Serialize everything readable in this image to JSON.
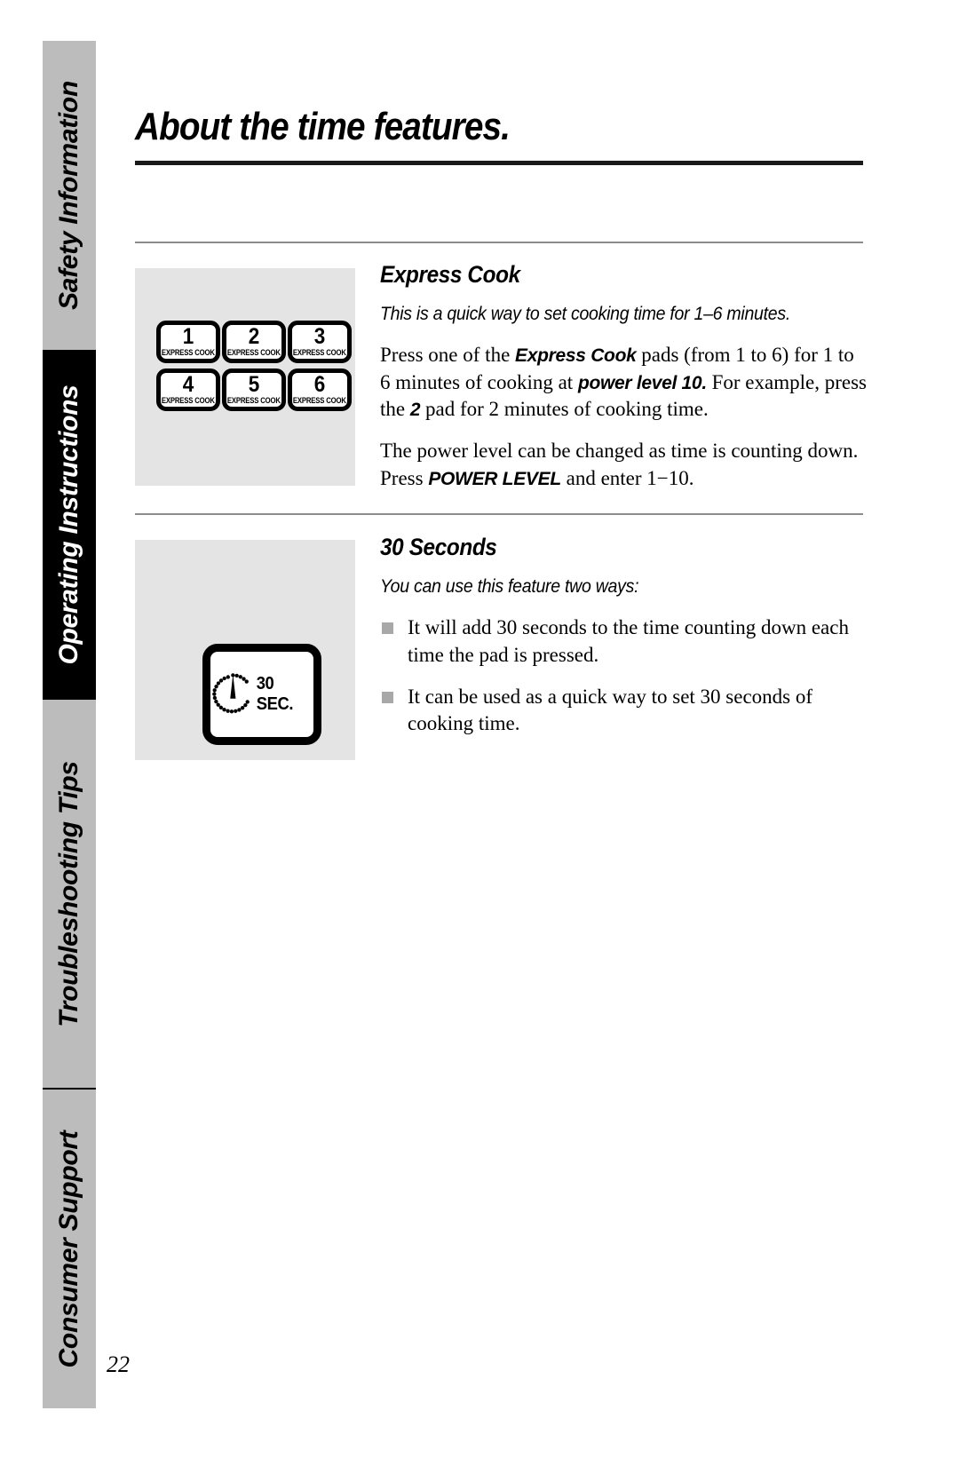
{
  "page": {
    "title": "About the time features.",
    "number": "22"
  },
  "sidebar": {
    "tabs": [
      {
        "label": "Safety Information",
        "active": false
      },
      {
        "label": "Operating Instructions",
        "active": true
      },
      {
        "label": "Troubleshooting Tips",
        "active": false
      },
      {
        "label": "Consumer Support",
        "active": false
      }
    ]
  },
  "sections": {
    "express_cook": {
      "heading": "Express Cook",
      "intro": "This is a quick way to set cooking time for 1–6 minutes.",
      "para1_a": "Press one of the ",
      "para1_emph1": "Express Cook",
      "para1_b": " pads (from 1 to 6) for 1 to 6 minutes of cooking at ",
      "para1_emph2": "power level 10.",
      "para1_c": " For example, press the ",
      "para1_emph3": "2",
      "para1_d": " pad for 2 minutes of cooking time.",
      "para2_a": "The power level can be changed as time is counting down. Press ",
      "para2_emph1": "POWER LEVEL",
      "para2_b": " and enter 1−10.",
      "keypad": {
        "pads": [
          {
            "number": "1",
            "sub": "EXPRESS COOK"
          },
          {
            "number": "2",
            "sub": "EXPRESS COOK"
          },
          {
            "number": "3",
            "sub": "EXPRESS COOK"
          },
          {
            "number": "4",
            "sub": "EXPRESS COOK"
          },
          {
            "number": "5",
            "sub": "EXPRESS COOK"
          },
          {
            "number": "6",
            "sub": "EXPRESS COOK"
          }
        ]
      }
    },
    "thirty_seconds": {
      "heading": "30 Seconds",
      "intro": "You can use this feature two ways:",
      "bullets": [
        "It will add 30 seconds to the time counting down each time the pad is pressed.",
        "It can be used as a quick way to set 30 seconds of cooking time."
      ],
      "pad_label": "30 SEC.",
      "pad_icon": "timer-dial-icon"
    }
  },
  "colors": {
    "tab_inactive": "#bcbcbc",
    "tab_active": "#000000",
    "panel_background": "#e4e4e4",
    "rule": "#8c8c8c",
    "title_rule": "#1a1a1a",
    "bullet": "#a8a8a8"
  }
}
